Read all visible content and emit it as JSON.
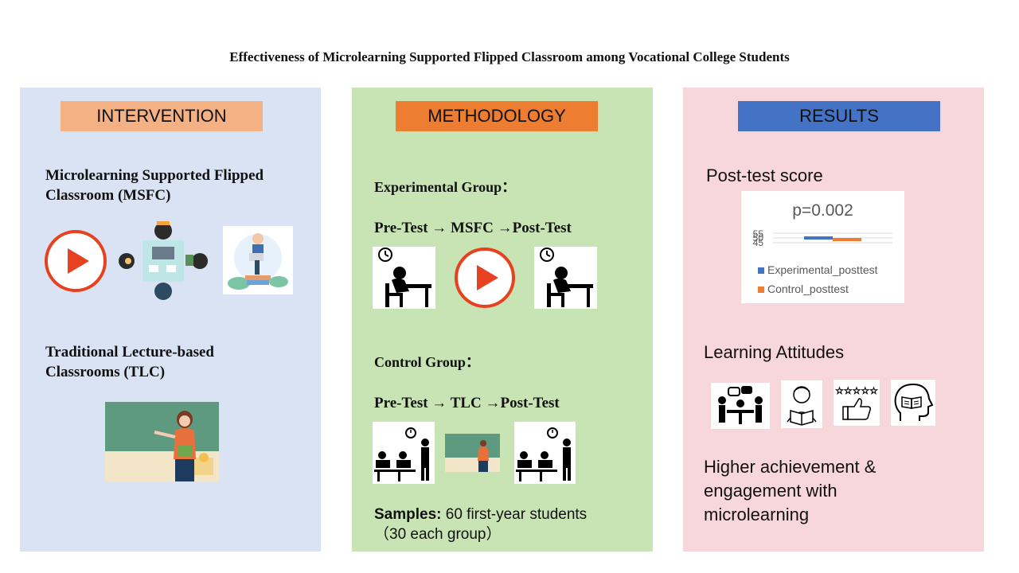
{
  "title": "Effectiveness of Microlearning Supported Flipped Classroom among Vocational College Students",
  "intervention": {
    "header": "INTERVENTION",
    "msfc_line1": "Microlearning Supported Flipped",
    "msfc_line2": "Classroom (MSFC)",
    "tlc_line1": "Traditional Lecture-based",
    "tlc_line2": "Classrooms (TLC)"
  },
  "methodology": {
    "header": "METHODOLOGY",
    "exp_label": "Experimental Group：",
    "exp_flow": "Pre-Test → MSFC →Post-Test",
    "ctrl_label": "Control Group：",
    "ctrl_flow": "Pre-Test → TLC →Post-Test",
    "samples_label": "Samples:",
    "samples_text": " 60 first-year students",
    "samples_text2": "（30 each group）"
  },
  "results": {
    "header": "RESULTS",
    "posttest_label": "Post-test score",
    "attitudes_label": "Learning Attitudes",
    "conclusion_line1": "Higher achievement &",
    "conclusion_line2": "engagement with",
    "conclusion_line3": "microlearning"
  },
  "colors": {
    "intervention_header": "#f4b183",
    "methodology_header": "#ed7d31",
    "results_header": "#4472c4",
    "experimental": "#4472c4",
    "control": "#ed7d31"
  },
  "chart_data": {
    "type": "bar",
    "title": "p=0.002",
    "tick_labels": [
      "55",
      "50",
      "45"
    ],
    "series": [
      {
        "name": "Experimental_posttest",
        "color": "#4472c4"
      },
      {
        "name": "Control_posttest",
        "color": "#ed7d31"
      }
    ],
    "legend_position": "bottom"
  }
}
